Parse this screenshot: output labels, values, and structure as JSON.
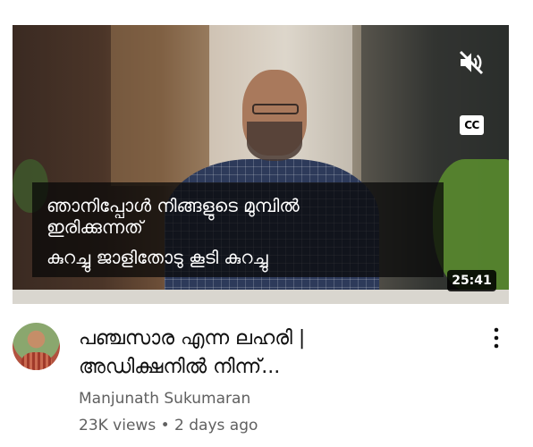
{
  "video": {
    "captions": [
      "ഞാനിപ്പോൾ നിങ്ങളുടെ മുമ്പിൽ",
      "ഇരിക്കുന്നത്",
      "കുറച്ചു ജാളിതോടു കൂടി കുറച്ചു"
    ],
    "cc_label": "CC",
    "duration": "25:41",
    "mute_icon": "speaker-muted-icon"
  },
  "details": {
    "title_lines": [
      "പഞ്ചസാര എന്ന ലഹരി |",
      "അഡിക്ഷനിൽ നിന്ന്..."
    ],
    "channel": "Manjunath Sukumaran",
    "views": "23K views",
    "separator": "•",
    "age": "2 days ago"
  }
}
